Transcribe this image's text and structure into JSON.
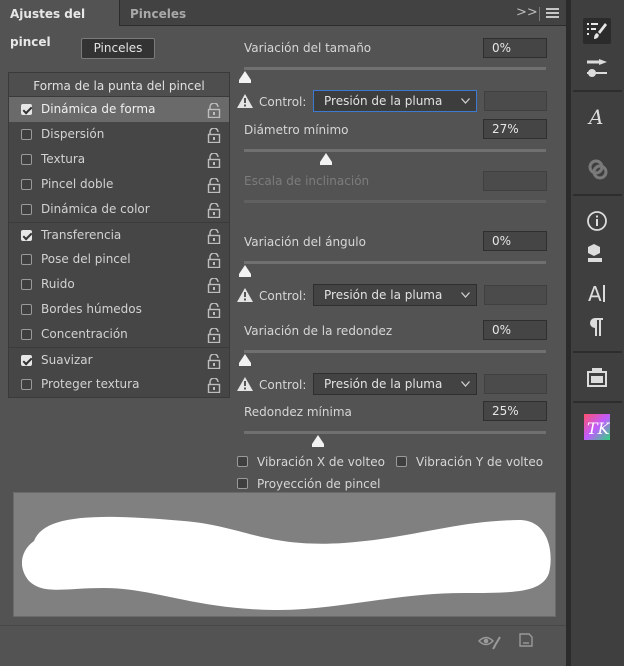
{
  "tabs": {
    "active": "Ajustes del pincel",
    "inactive": "Pinceles",
    "chevrons": ">>"
  },
  "pinceles_button": "Pinceles",
  "list": {
    "header": "Forma de la punta del pincel",
    "items": [
      {
        "label": "Dinámica de forma",
        "checked": true,
        "selected": true
      },
      {
        "label": "Dispersión",
        "checked": false
      },
      {
        "label": "Textura",
        "checked": false
      },
      {
        "label": "Pincel doble",
        "checked": false
      },
      {
        "label": "Dinámica de color",
        "checked": false
      },
      {
        "label": "Transferencia",
        "checked": true
      },
      {
        "label": "Pose del pincel",
        "checked": false
      },
      {
        "label": "Ruido",
        "checked": false
      },
      {
        "label": "Bordes húmedos",
        "checked": false
      },
      {
        "label": "Concentración",
        "checked": false
      },
      {
        "label": "Suavizar",
        "checked": true
      },
      {
        "label": "Proteger textura",
        "checked": false
      }
    ]
  },
  "controls": {
    "size_jitter": {
      "label": "Variación del tamaño",
      "value": "0%"
    },
    "control1": {
      "label": "Control:",
      "value": "Presión de la pluma"
    },
    "min_diameter": {
      "label": "Diámetro mínimo",
      "value": "27%"
    },
    "tilt_scale": {
      "label": "Escala de inclinación",
      "value": ""
    },
    "angle_jitter": {
      "label": "Variación del ángulo",
      "value": "0%"
    },
    "control2": {
      "label": "Control:",
      "value": "Presión de la pluma"
    },
    "roundness_jitter": {
      "label": "Variación de la redondez",
      "value": "0%"
    },
    "control3": {
      "label": "Control:",
      "value": "Presión de la pluma"
    },
    "min_roundness": {
      "label": "Redondez mínima",
      "value": "25%"
    }
  },
  "options": {
    "flip_x": "Vibración X de volteo",
    "flip_y": "Vibración Y de volteo",
    "projection": "Proyección de pincel"
  },
  "dock_icons": [
    "brush-settings-icon",
    "brush-presets-icon",
    "character-styles-icon",
    "clone-source-icon",
    "info-icon",
    "3d-materials-icon",
    "character-icon",
    "paragraph-icon",
    "layer-comps-icon",
    "tk-plugin-icon"
  ]
}
